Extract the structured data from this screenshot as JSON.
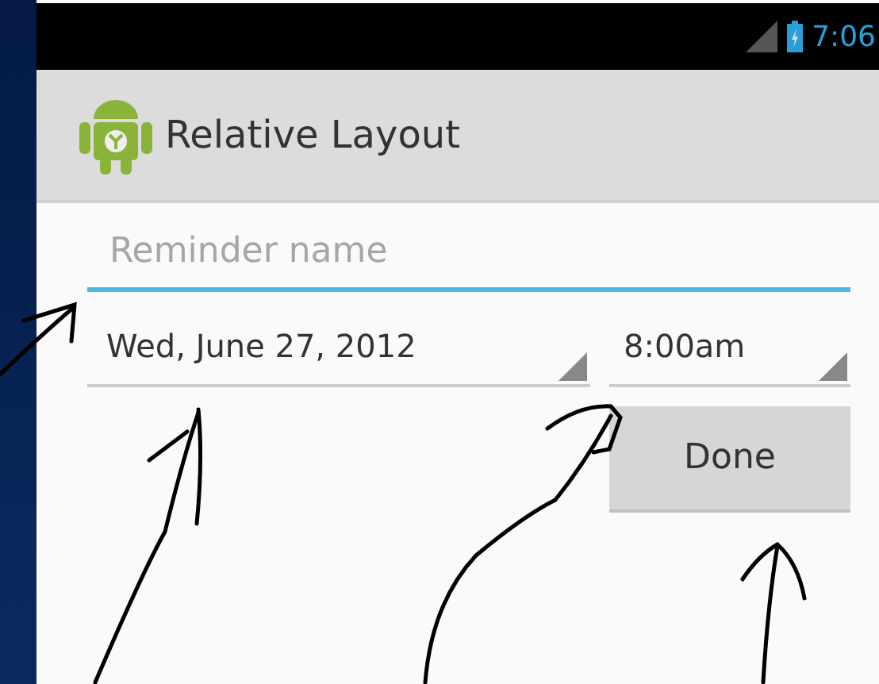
{
  "status_bar": {
    "time": "7:06"
  },
  "action_bar": {
    "title": "Relative Layout"
  },
  "reminder_field": {
    "placeholder": "Reminder name"
  },
  "date_spinner": {
    "value": "Wed, June 27, 2012"
  },
  "time_spinner": {
    "value": "8:00am"
  },
  "done_button": {
    "label": "Done"
  }
}
